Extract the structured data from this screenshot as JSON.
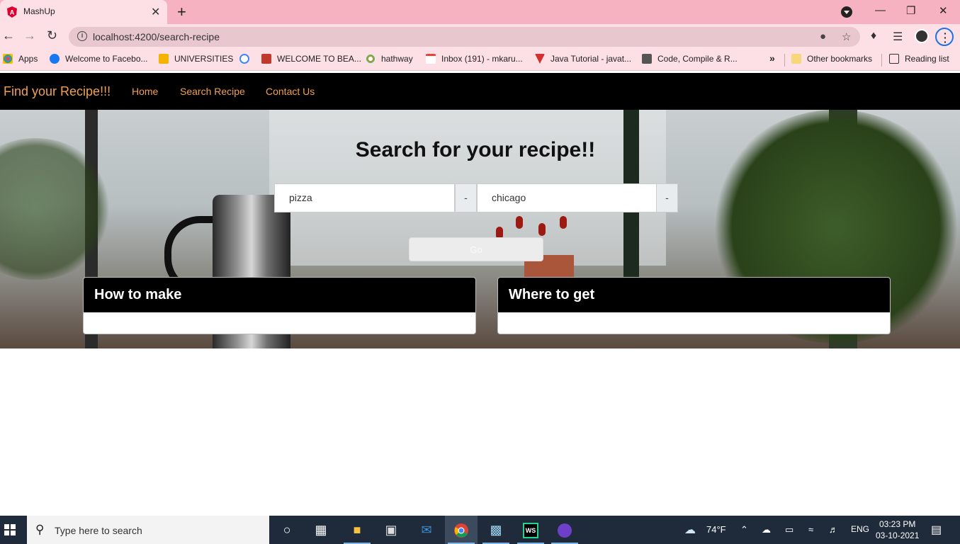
{
  "browser": {
    "tab_title": "MashUp",
    "tab_close": "✕",
    "new_tab": "+",
    "win_minimize": "—",
    "win_restore": "❐",
    "win_close": "✕",
    "url": "localhost:4200/search-recipe",
    "bookmarks": [
      {
        "label": "Apps",
        "color": "#e44"
      },
      {
        "label": "Welcome to Facebo...",
        "color": "#1877f2"
      },
      {
        "label": "UNIVERSITIES",
        "color": "#f5b300"
      },
      {
        "label": "",
        "color": "#4285f4"
      },
      {
        "label": "WELCOME TO BEA...",
        "color": "#c0392b"
      },
      {
        "label": "hathway",
        "color": "#e67e22"
      },
      {
        "label": "Inbox (191) - mkaru...",
        "color": "#ea4335"
      },
      {
        "label": "Java Tutorial - javat...",
        "color": "#d32f2f"
      },
      {
        "label": "Code, Compile & R...",
        "color": "#555"
      }
    ],
    "more_bookmarks": "»",
    "other_bookmarks": "Other bookmarks",
    "reading_list": "Reading list"
  },
  "page": {
    "brand": "Find your Recipe!!!",
    "nav": [
      "Home",
      "Search Recipe",
      "Contact Us"
    ],
    "heading": "Search for your recipe!!",
    "query_value": "pizza",
    "location_value": "chicago",
    "addon": "-",
    "go_label": "Go",
    "cards": [
      "How to make",
      "Where to get"
    ]
  },
  "taskbar": {
    "search_placeholder": "Type here to search",
    "temperature": "74°F",
    "language": "ENG",
    "time": "03:23 PM",
    "date": "03-10-2021"
  }
}
